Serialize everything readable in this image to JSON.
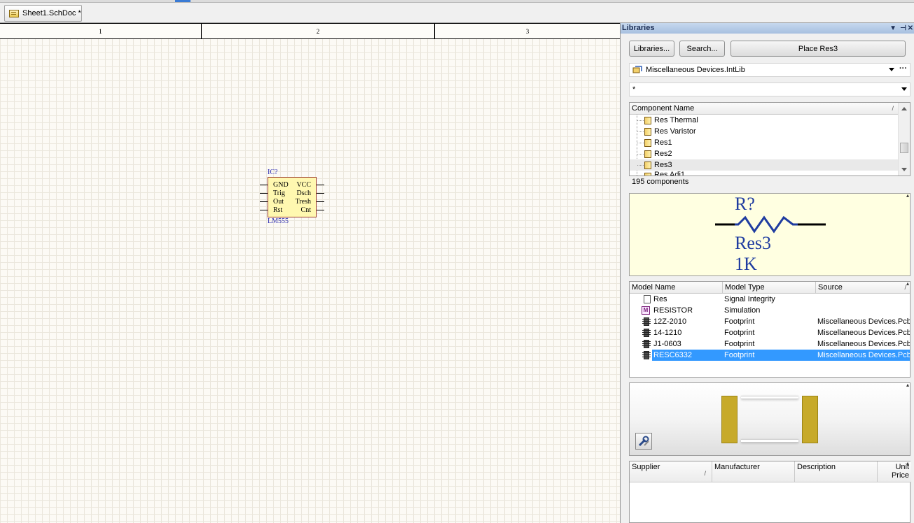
{
  "tab": {
    "label": "Sheet1.SchDoc *"
  },
  "schematic": {
    "zones": [
      "1",
      "2",
      "3"
    ],
    "component": {
      "designator": "IC?",
      "comment": "LM555",
      "left_pins": [
        "GND",
        "Trig",
        "Out",
        "Rst"
      ],
      "right_pins": [
        "VCC",
        "Dsch",
        "Tresh",
        "Cnt"
      ]
    }
  },
  "panel": {
    "title": "Libraries",
    "buttons": {
      "libraries": "Libraries...",
      "search": "Search...",
      "place": "Place Res3"
    },
    "library_select": "Miscellaneous Devices.IntLib",
    "filter": "*",
    "component_header": "Component Name",
    "components": [
      "Res Thermal",
      "Res Varistor",
      "Res1",
      "Res2",
      "Res3",
      "Res Adj1"
    ],
    "selected_component": "Res3",
    "component_count": "195 components",
    "preview": {
      "designator": "R?",
      "name": "Res3",
      "value": "1K"
    },
    "model_headers": [
      "Model Name",
      "Model Type",
      "Source"
    ],
    "models": [
      {
        "name": "Res",
        "type": "Signal Integrity",
        "source": "",
        "icon": "signal-integrity-icon"
      },
      {
        "name": "RESISTOR",
        "type": "Simulation",
        "source": "",
        "icon": "simulation-icon"
      },
      {
        "name": "12Z-2010",
        "type": "Footprint",
        "source": "Miscellaneous Devices.Pcb",
        "icon": "footprint-icon"
      },
      {
        "name": "14-1210",
        "type": "Footprint",
        "source": "Miscellaneous Devices.Pcb",
        "icon": "footprint-icon"
      },
      {
        "name": "J1-0603",
        "type": "Footprint",
        "source": "Miscellaneous Devices.Pcb",
        "icon": "footprint-icon"
      },
      {
        "name": "RESC6332",
        "type": "Footprint",
        "source": "Miscellaneous Devices.Pcb",
        "icon": "footprint-icon"
      }
    ],
    "supplier_headers": {
      "supplier": "Supplier",
      "manufacturer": "Manufacturer",
      "description": "Description",
      "unit_price": "Unit Price"
    },
    "colors": {
      "title_bar": "#a7c0e0",
      "selection": "#3399ff",
      "preview_bg": "#ffffe1",
      "pad": "#c7aa2a",
      "symbol": "#1f3ca0"
    }
  }
}
